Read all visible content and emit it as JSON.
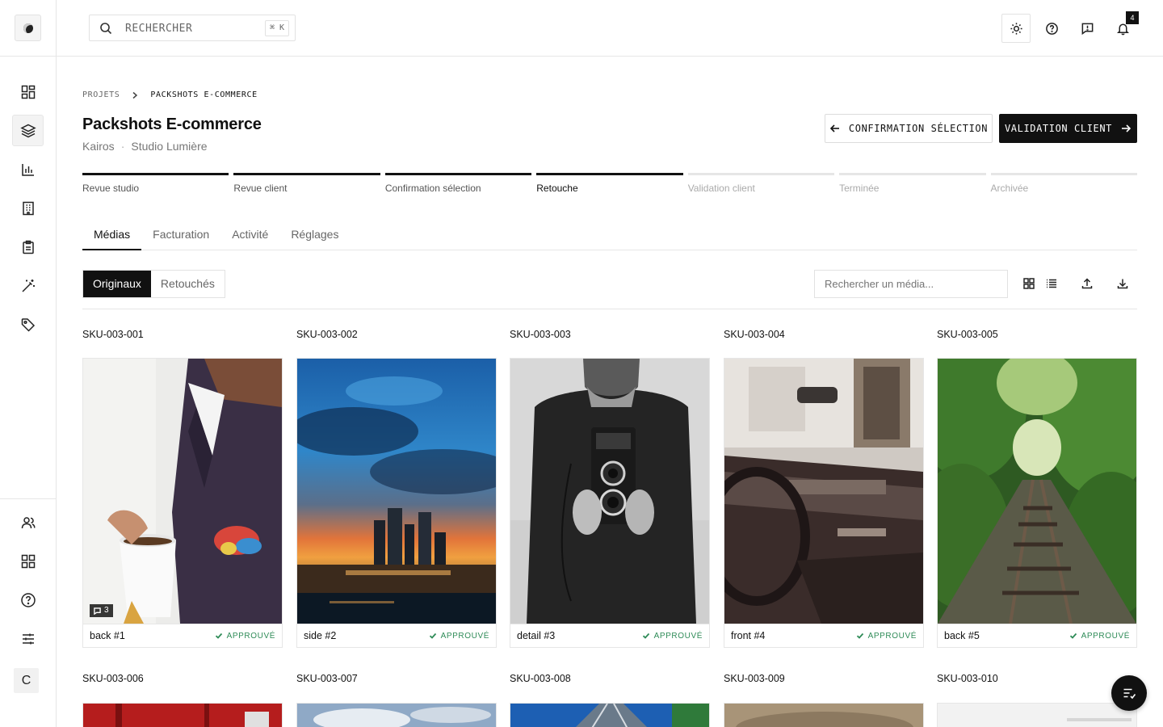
{
  "search": {
    "placeholder": "RECHERCHER",
    "shortcut": "⌘ K"
  },
  "notifications": {
    "count": "4"
  },
  "breadcrumb": {
    "root": "PROJETS",
    "current": "PACKSHOTS E-COMMERCE"
  },
  "project": {
    "title": "Packshots E-commerce",
    "client": "Kairos",
    "studio": "Studio Lumière"
  },
  "actions": {
    "prev_label": "CONFIRMATION SÉLECTION",
    "next_label": "VALIDATION CLIENT"
  },
  "steps": [
    {
      "label": "Revue studio",
      "state": "done"
    },
    {
      "label": "Revue client",
      "state": "done"
    },
    {
      "label": "Confirmation sélection",
      "state": "done"
    },
    {
      "label": "Retouche",
      "state": "current"
    },
    {
      "label": "Validation client",
      "state": "todo"
    },
    {
      "label": "Terminée",
      "state": "todo"
    },
    {
      "label": "Archivée",
      "state": "todo"
    }
  ],
  "tabs": [
    "Médias",
    "Facturation",
    "Activité",
    "Réglages"
  ],
  "segment": {
    "originals": "Originaux",
    "retouched": "Retouchés"
  },
  "media_search": {
    "placeholder": "Rechercher un média..."
  },
  "media": [
    {
      "sku": "SKU-003-001",
      "name": "back #1",
      "status": "APPROUVÉ",
      "comments": "3"
    },
    {
      "sku": "SKU-003-002",
      "name": "side #2",
      "status": "APPROUVÉ"
    },
    {
      "sku": "SKU-003-003",
      "name": "detail #3",
      "status": "APPROUVÉ"
    },
    {
      "sku": "SKU-003-004",
      "name": "front #4",
      "status": "APPROUVÉ"
    },
    {
      "sku": "SKU-003-005",
      "name": "back #5",
      "status": "APPROUVÉ"
    },
    {
      "sku": "SKU-003-006"
    },
    {
      "sku": "SKU-003-007"
    },
    {
      "sku": "SKU-003-008"
    },
    {
      "sku": "SKU-003-009"
    },
    {
      "sku": "SKU-003-010"
    }
  ],
  "user": {
    "initial": "C"
  },
  "colors": {
    "accent": "#111111",
    "approved": "#2e8b57",
    "border": "#e6e6e6"
  }
}
